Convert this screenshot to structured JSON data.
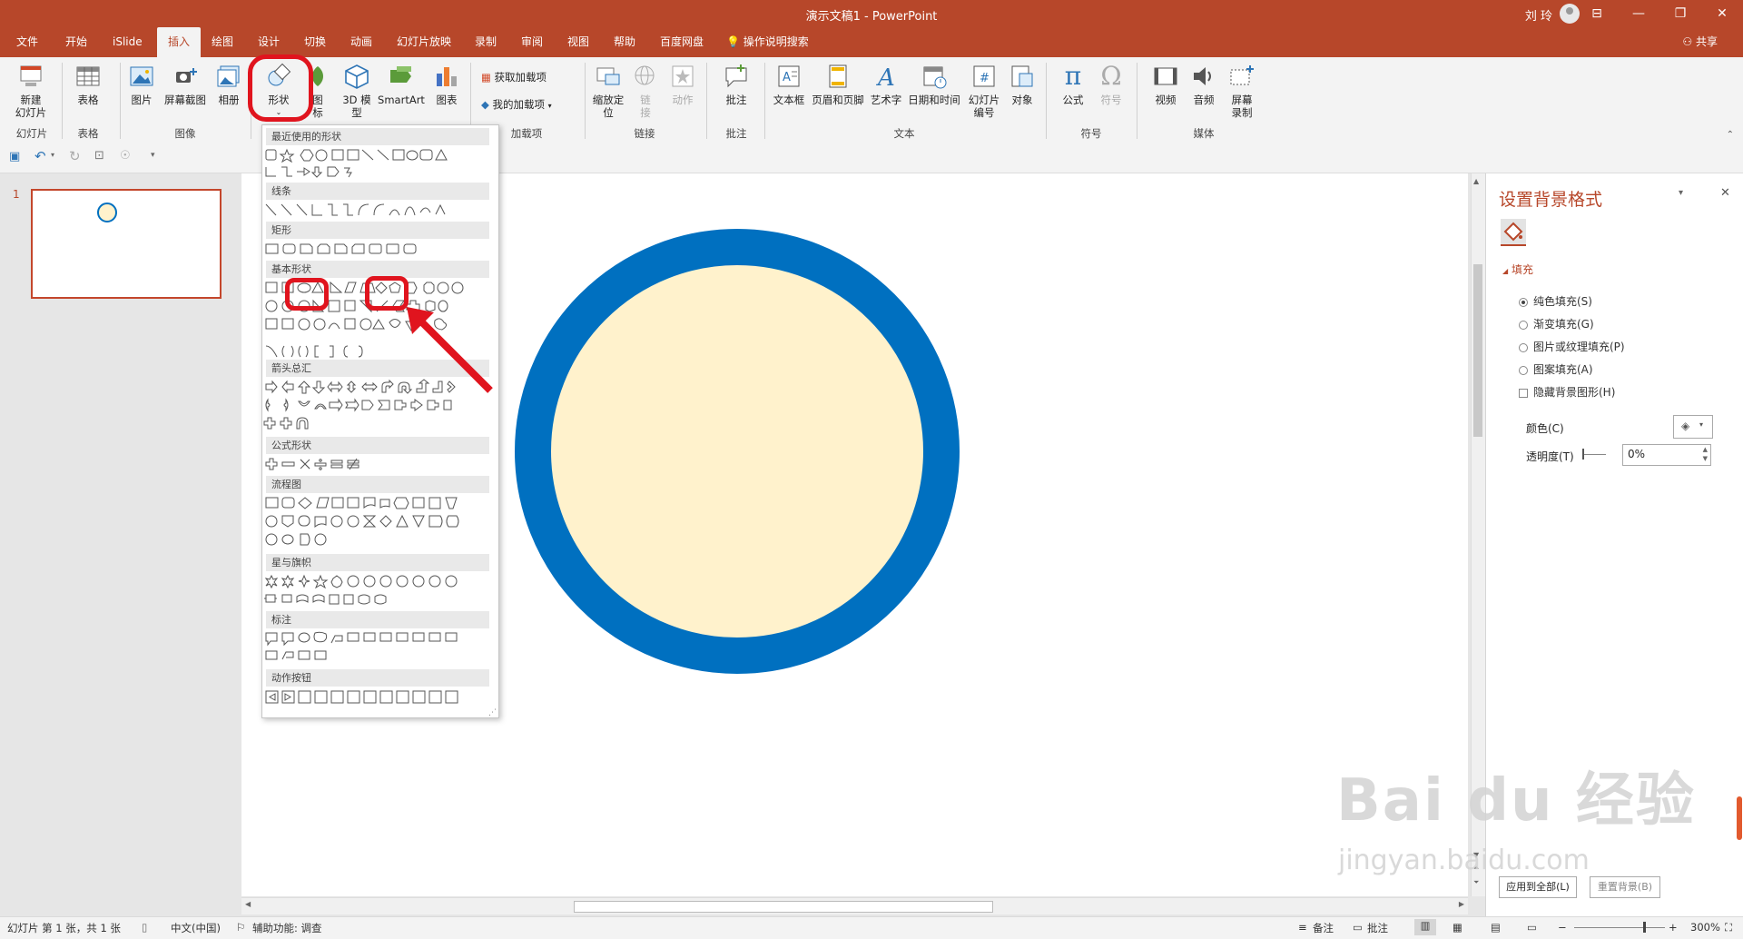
{
  "window": {
    "title": "演示文稿1  -  PowerPoint",
    "user": "刘 玲",
    "minimize": "—",
    "restore": "❐",
    "close": "✕",
    "ribbon_display": "⊟"
  },
  "tabs": [
    "文件",
    "开始",
    "iSlide",
    "插入",
    "绘图",
    "设计",
    "切换",
    "动画",
    "幻灯片放映",
    "录制",
    "审阅",
    "视图",
    "帮助",
    "百度网盘"
  ],
  "active_tab": "插入",
  "tell_me": "操作说明搜索",
  "share": "共享",
  "ribbon": {
    "new_slide": "新建\n幻灯片",
    "group_slides": "幻灯片",
    "table": "表格",
    "group_table": "表格",
    "picture": "图片",
    "screenshot": "屏幕截图",
    "album": "相册",
    "group_images": "图像",
    "shapes": "形状",
    "icons": "图\n标",
    "model3d": "3D 模\n型",
    "smartart": "SmartArt",
    "chart": "图表",
    "get_addins": "获取加载项",
    "my_addins": "我的加载项",
    "group_addins": "加载项",
    "zoom": "缩放定\n位",
    "link": "链\n接",
    "action": "动作",
    "group_links": "链接",
    "comment": "批注",
    "group_comments": "批注",
    "textbox": "文本框",
    "header_footer": "页眉和页脚",
    "wordart": "艺术字",
    "datetime": "日期和时间",
    "slide_number": "幻灯片\n编号",
    "object": "对象",
    "group_text": "文本",
    "equation": "公式",
    "symbol": "符号",
    "group_symbols": "符号",
    "video": "视频",
    "audio": "音频",
    "screen_record": "屏幕\n录制",
    "group_media": "媒体"
  },
  "thumbnail": {
    "number": "1"
  },
  "gallery": {
    "sections": [
      "最近使用的形状",
      "线条",
      "矩形",
      "基本形状",
      "箭头总汇",
      "公式形状",
      "流程图",
      "星与旗帜",
      "标注",
      "动作按钮"
    ]
  },
  "format_pane": {
    "title": "设置背景格式",
    "section": "填充",
    "options": [
      "纯色填充(S)",
      "渐变填充(G)",
      "图片或纹理填充(P)",
      "图案填充(A)"
    ],
    "selected_option": "纯色填充(S)",
    "hide_bg": "隐藏背景图形(H)",
    "color_label": "颜色(C)",
    "transparency_label": "透明度(T)",
    "transparency_value": "0%",
    "apply_all": "应用到全部(L)",
    "reset": "重置背景(B)"
  },
  "status": {
    "slide_info": "幻灯片 第 1 张，共 1 张",
    "language": "中文(中国)",
    "accessibility": "辅助功能: 调查",
    "notes": "备注",
    "comments": "批注",
    "zoom": "300%"
  },
  "colors": {
    "accent": "#b7472a",
    "circle_fill": "#fff2cc",
    "circle_stroke": "#0070c0",
    "highlight": "#e0141e"
  },
  "watermark": {
    "logo": "Bai du 经验",
    "url": "jingyan.baidu.com"
  }
}
